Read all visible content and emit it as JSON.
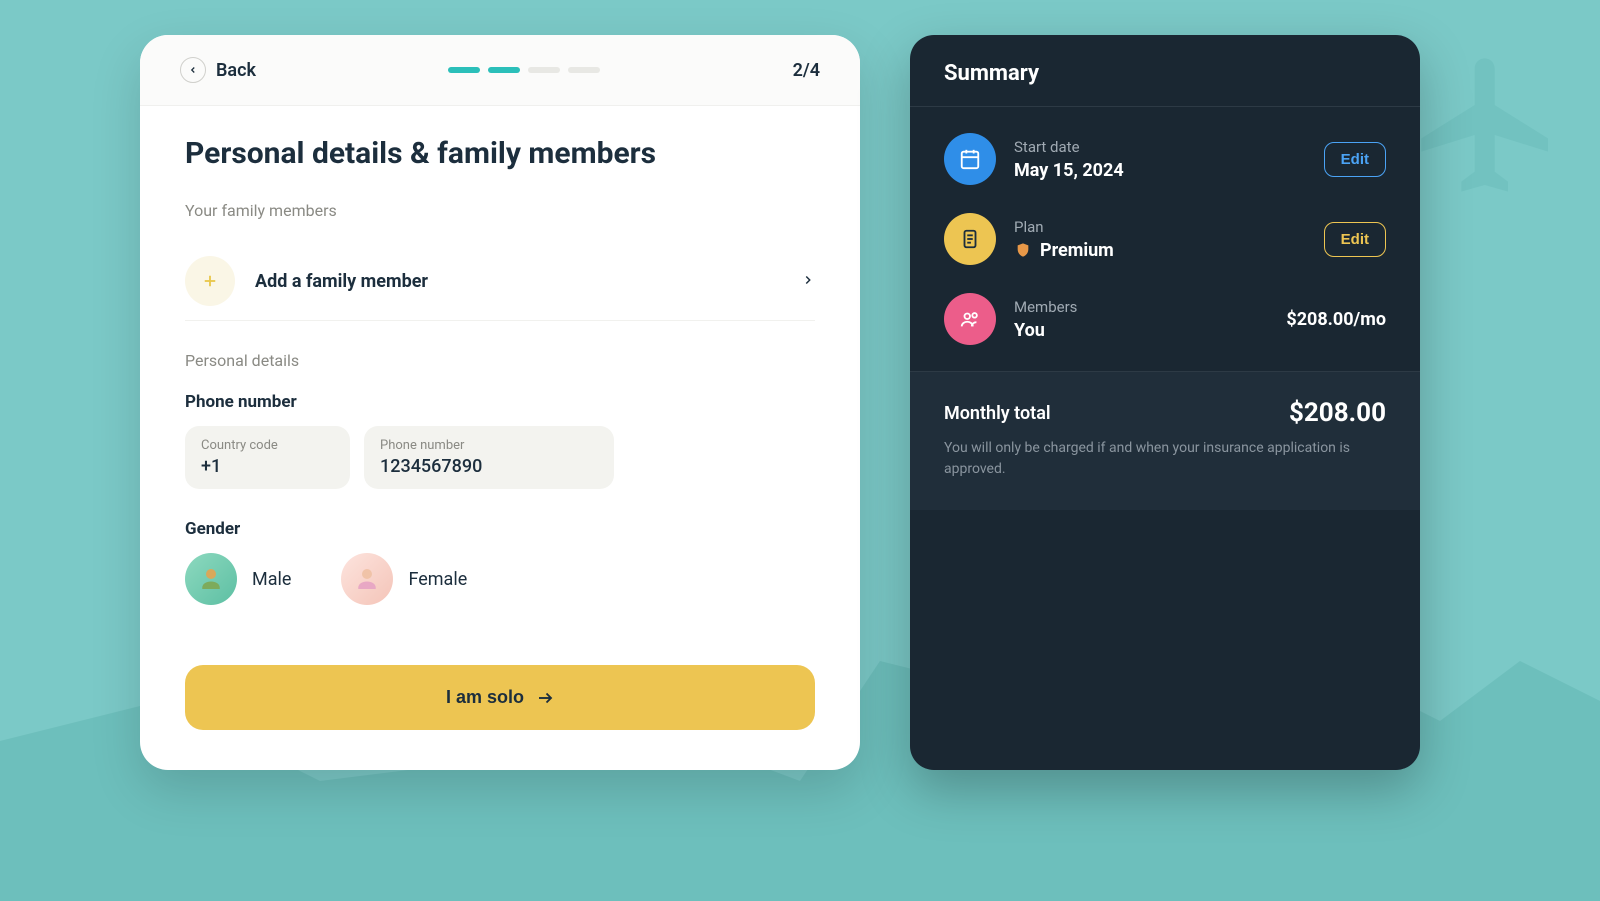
{
  "header": {
    "back_label": "Back",
    "step_indicator": "2/4",
    "progress": {
      "current": 2,
      "total": 4
    }
  },
  "main": {
    "title": "Personal details & family members",
    "family_section_label": "Your family members",
    "add_family_label": "Add a family member",
    "personal_section_label": "Personal details",
    "phone_label": "Phone number",
    "country_code": {
      "label": "Country code",
      "value": "+1"
    },
    "phone": {
      "label": "Phone number",
      "value": "1234567890"
    },
    "gender_label": "Gender",
    "gender_options": {
      "male": "Male",
      "female": "Female"
    },
    "primary_action": "I am solo"
  },
  "summary": {
    "title": "Summary",
    "edit_label": "Edit",
    "start_date": {
      "label": "Start date",
      "value": "May 15, 2024"
    },
    "plan": {
      "label": "Plan",
      "value": "Premium"
    },
    "members": {
      "label": "Members",
      "value": "You",
      "price": "$208.00/mo"
    },
    "monthly_total": {
      "label": "Monthly total",
      "value": "$208.00"
    },
    "footer_note": "You will only be charged if and when your insurance application is approved."
  }
}
